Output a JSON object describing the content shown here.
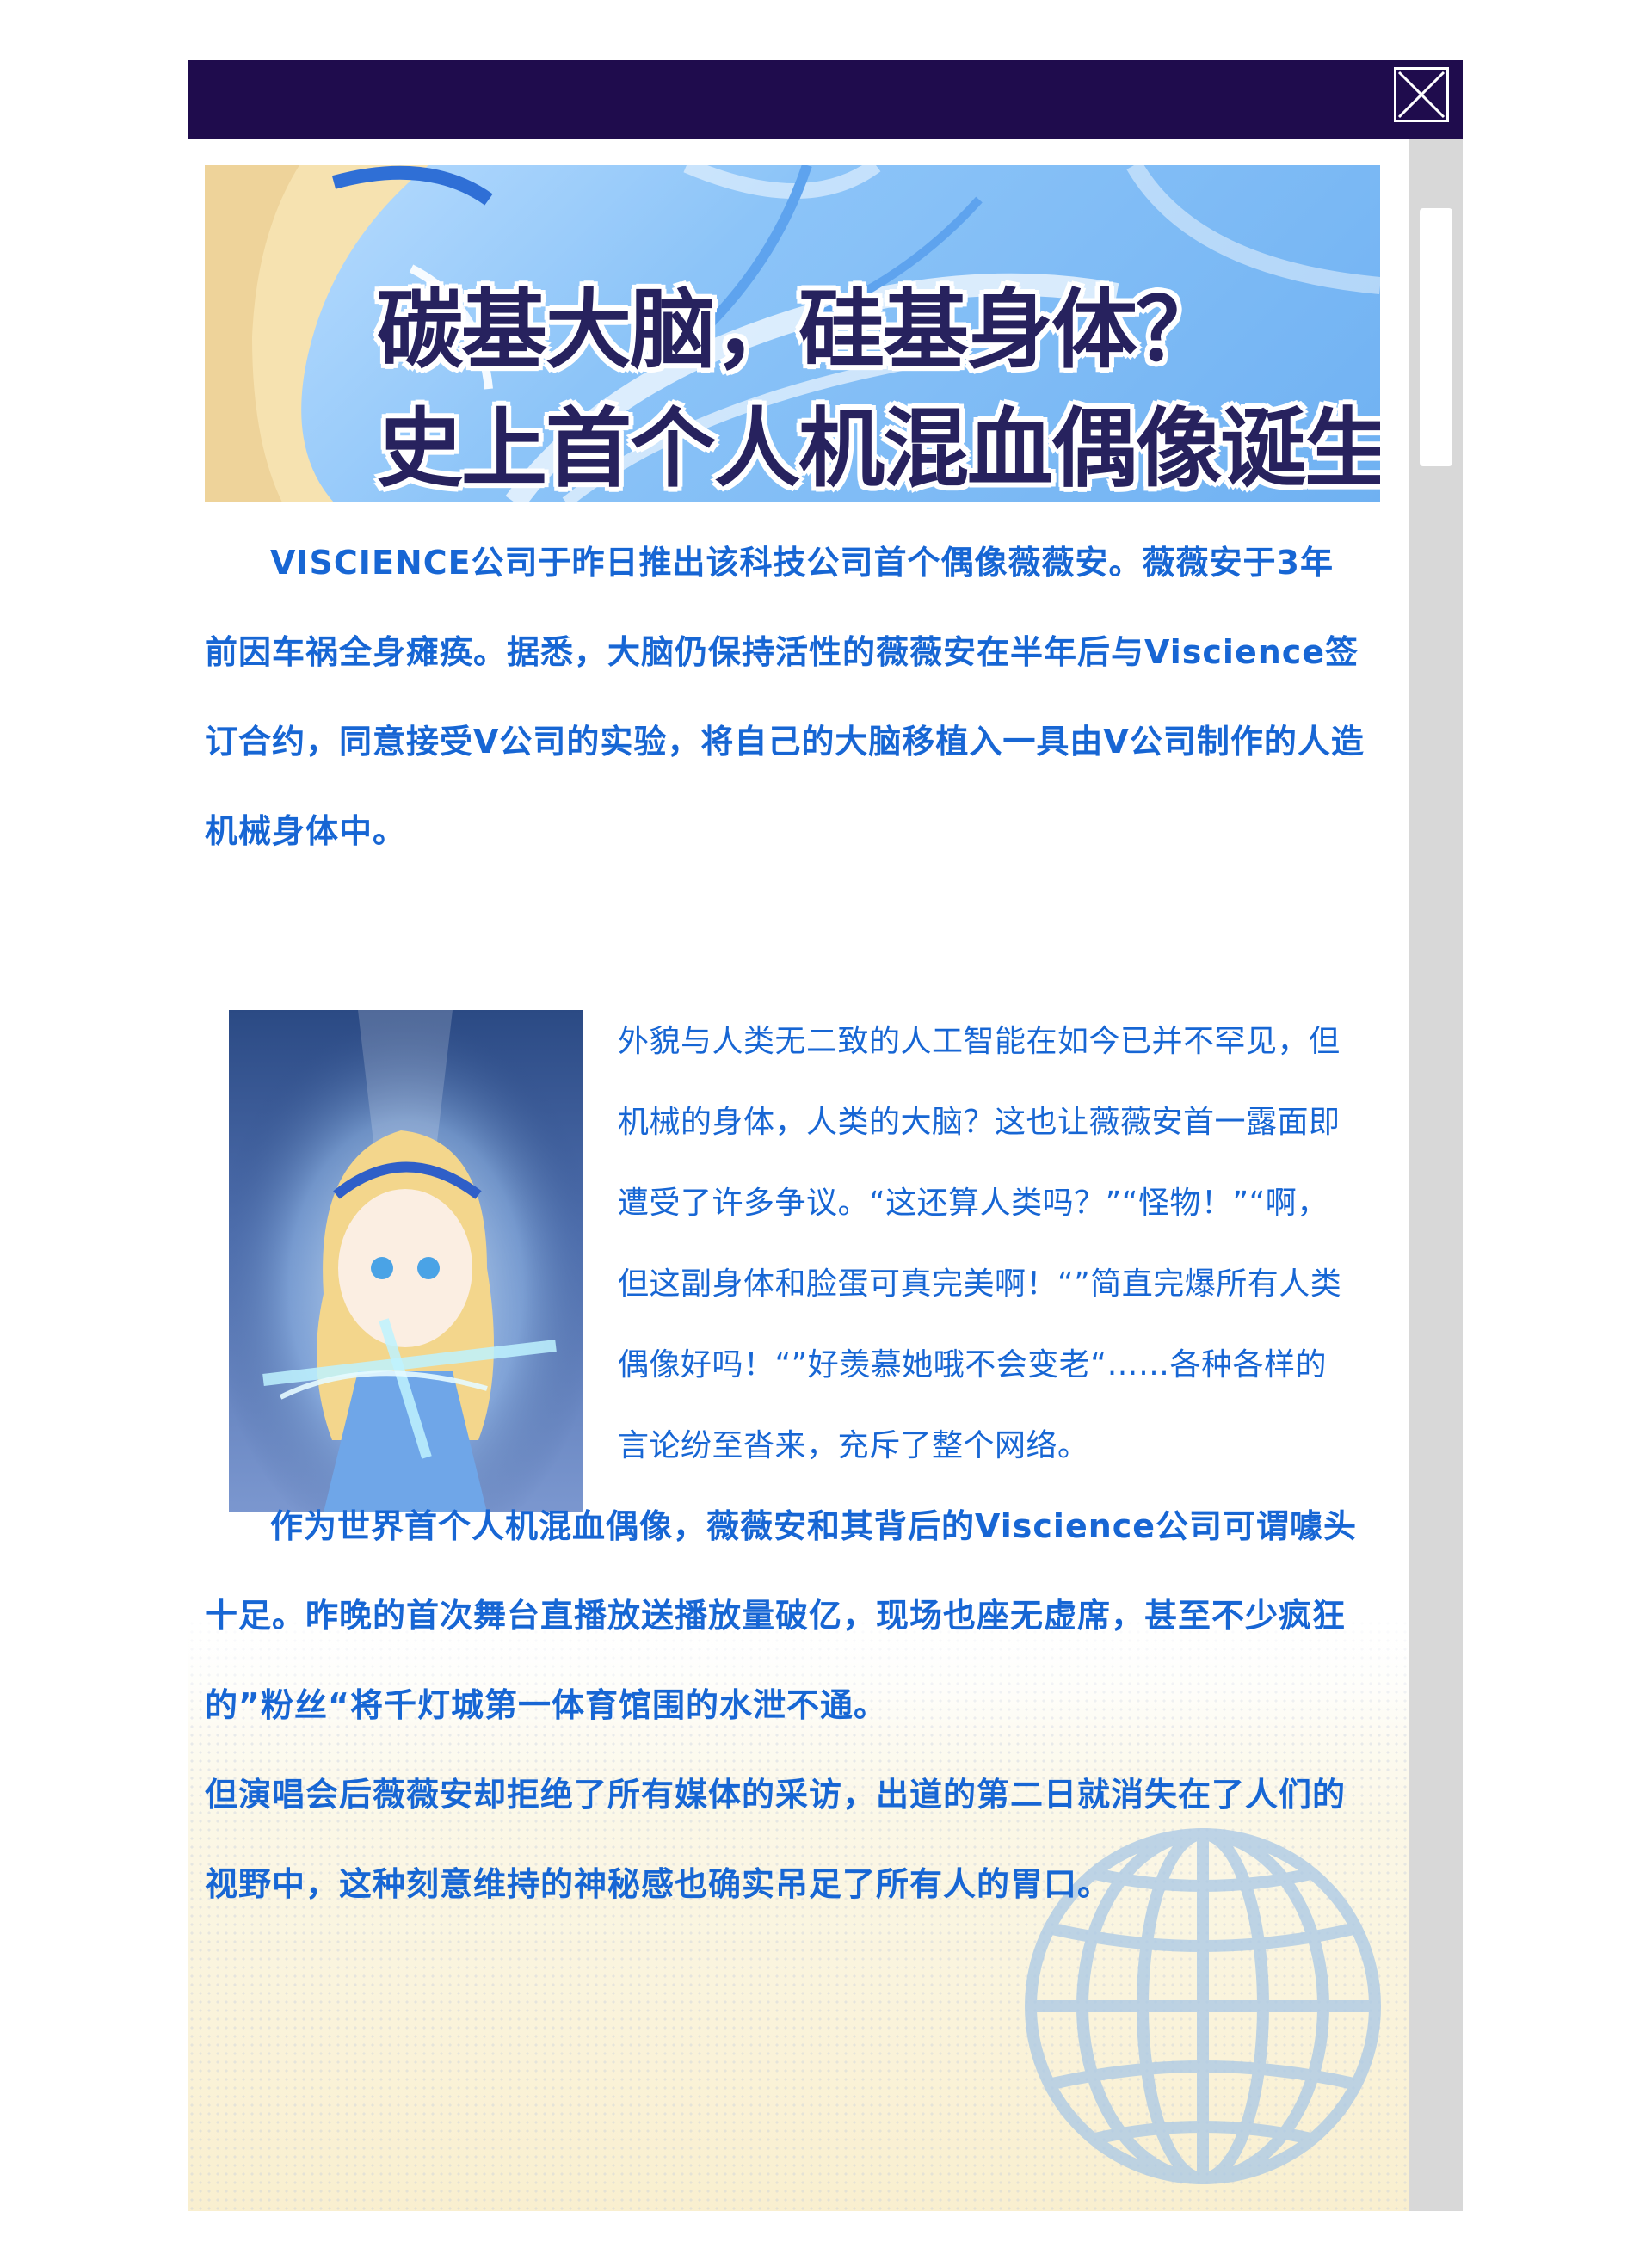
{
  "window": {
    "close_icon": "close-icon",
    "colors": {
      "titlebar": "#1f0c4d",
      "text": "#1766d4",
      "scrollbar_track": "#d8d8d8"
    }
  },
  "banner": {
    "line1": "碳基大脑，硅基身体？",
    "line2": "史上首个人机混血偶像诞生！"
  },
  "article": {
    "paragraph1": "VISCIENCE公司于昨日推出该科技公司首个偶像薇薇安。薇薇安于3年前因车祸全身瘫痪。据悉，大脑仍保持活性的薇薇安在半年后与Viscience签订合约，同意接受V公司的实验，将自己的大脑移植入一具由V公司制作的人造机械身体中。",
    "side_text": "外貌与人类无二致的人工智能在如今已并不罕见，但机械的身体，人类的大脑？这也让薇薇安首一露面即遭受了许多争议。“这还算人类吗？”“怪物！”“啊，但这副身体和脸蛋可真完美啊！“”简直完爆所有人类偶像好吗！“”好羡慕她哦不会变老“……各种各样的言论纷至沓来，充斥了整个网络。",
    "paragraph2": "作为世界首个人机混血偶像，薇薇安和其背后的Viscience公司可谓噱头十足。昨晚的首次舞台直播放送播放量破亿，现场也座无虚席，甚至不少疯狂的”粉丝“将千灯城第一体育馆围的水泄不通。",
    "paragraph3": "但演唱会后薇薇安却拒绝了所有媒体的采访，出道的第二日就消失在了人们的视野中，这种刻意维持的神秘感也确实吊足了所有人的胃口。"
  }
}
